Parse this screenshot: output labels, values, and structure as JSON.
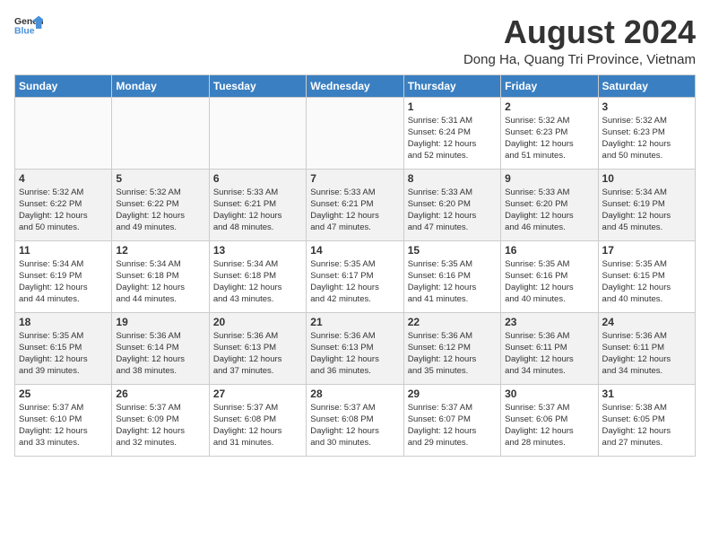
{
  "logo": {
    "text_general": "General",
    "text_blue": "Blue"
  },
  "header": {
    "title": "August 2024",
    "subtitle": "Dong Ha, Quang Tri Province, Vietnam"
  },
  "weekdays": [
    "Sunday",
    "Monday",
    "Tuesday",
    "Wednesday",
    "Thursday",
    "Friday",
    "Saturday"
  ],
  "weeks": [
    [
      {
        "day": "",
        "info": ""
      },
      {
        "day": "",
        "info": ""
      },
      {
        "day": "",
        "info": ""
      },
      {
        "day": "",
        "info": ""
      },
      {
        "day": "1",
        "info": "Sunrise: 5:31 AM\nSunset: 6:24 PM\nDaylight: 12 hours\nand 52 minutes."
      },
      {
        "day": "2",
        "info": "Sunrise: 5:32 AM\nSunset: 6:23 PM\nDaylight: 12 hours\nand 51 minutes."
      },
      {
        "day": "3",
        "info": "Sunrise: 5:32 AM\nSunset: 6:23 PM\nDaylight: 12 hours\nand 50 minutes."
      }
    ],
    [
      {
        "day": "4",
        "info": "Sunrise: 5:32 AM\nSunset: 6:22 PM\nDaylight: 12 hours\nand 50 minutes."
      },
      {
        "day": "5",
        "info": "Sunrise: 5:32 AM\nSunset: 6:22 PM\nDaylight: 12 hours\nand 49 minutes."
      },
      {
        "day": "6",
        "info": "Sunrise: 5:33 AM\nSunset: 6:21 PM\nDaylight: 12 hours\nand 48 minutes."
      },
      {
        "day": "7",
        "info": "Sunrise: 5:33 AM\nSunset: 6:21 PM\nDaylight: 12 hours\nand 47 minutes."
      },
      {
        "day": "8",
        "info": "Sunrise: 5:33 AM\nSunset: 6:20 PM\nDaylight: 12 hours\nand 47 minutes."
      },
      {
        "day": "9",
        "info": "Sunrise: 5:33 AM\nSunset: 6:20 PM\nDaylight: 12 hours\nand 46 minutes."
      },
      {
        "day": "10",
        "info": "Sunrise: 5:34 AM\nSunset: 6:19 PM\nDaylight: 12 hours\nand 45 minutes."
      }
    ],
    [
      {
        "day": "11",
        "info": "Sunrise: 5:34 AM\nSunset: 6:19 PM\nDaylight: 12 hours\nand 44 minutes."
      },
      {
        "day": "12",
        "info": "Sunrise: 5:34 AM\nSunset: 6:18 PM\nDaylight: 12 hours\nand 44 minutes."
      },
      {
        "day": "13",
        "info": "Sunrise: 5:34 AM\nSunset: 6:18 PM\nDaylight: 12 hours\nand 43 minutes."
      },
      {
        "day": "14",
        "info": "Sunrise: 5:35 AM\nSunset: 6:17 PM\nDaylight: 12 hours\nand 42 minutes."
      },
      {
        "day": "15",
        "info": "Sunrise: 5:35 AM\nSunset: 6:16 PM\nDaylight: 12 hours\nand 41 minutes."
      },
      {
        "day": "16",
        "info": "Sunrise: 5:35 AM\nSunset: 6:16 PM\nDaylight: 12 hours\nand 40 minutes."
      },
      {
        "day": "17",
        "info": "Sunrise: 5:35 AM\nSunset: 6:15 PM\nDaylight: 12 hours\nand 40 minutes."
      }
    ],
    [
      {
        "day": "18",
        "info": "Sunrise: 5:35 AM\nSunset: 6:15 PM\nDaylight: 12 hours\nand 39 minutes."
      },
      {
        "day": "19",
        "info": "Sunrise: 5:36 AM\nSunset: 6:14 PM\nDaylight: 12 hours\nand 38 minutes."
      },
      {
        "day": "20",
        "info": "Sunrise: 5:36 AM\nSunset: 6:13 PM\nDaylight: 12 hours\nand 37 minutes."
      },
      {
        "day": "21",
        "info": "Sunrise: 5:36 AM\nSunset: 6:13 PM\nDaylight: 12 hours\nand 36 minutes."
      },
      {
        "day": "22",
        "info": "Sunrise: 5:36 AM\nSunset: 6:12 PM\nDaylight: 12 hours\nand 35 minutes."
      },
      {
        "day": "23",
        "info": "Sunrise: 5:36 AM\nSunset: 6:11 PM\nDaylight: 12 hours\nand 34 minutes."
      },
      {
        "day": "24",
        "info": "Sunrise: 5:36 AM\nSunset: 6:11 PM\nDaylight: 12 hours\nand 34 minutes."
      }
    ],
    [
      {
        "day": "25",
        "info": "Sunrise: 5:37 AM\nSunset: 6:10 PM\nDaylight: 12 hours\nand 33 minutes."
      },
      {
        "day": "26",
        "info": "Sunrise: 5:37 AM\nSunset: 6:09 PM\nDaylight: 12 hours\nand 32 minutes."
      },
      {
        "day": "27",
        "info": "Sunrise: 5:37 AM\nSunset: 6:08 PM\nDaylight: 12 hours\nand 31 minutes."
      },
      {
        "day": "28",
        "info": "Sunrise: 5:37 AM\nSunset: 6:08 PM\nDaylight: 12 hours\nand 30 minutes."
      },
      {
        "day": "29",
        "info": "Sunrise: 5:37 AM\nSunset: 6:07 PM\nDaylight: 12 hours\nand 29 minutes."
      },
      {
        "day": "30",
        "info": "Sunrise: 5:37 AM\nSunset: 6:06 PM\nDaylight: 12 hours\nand 28 minutes."
      },
      {
        "day": "31",
        "info": "Sunrise: 5:38 AM\nSunset: 6:05 PM\nDaylight: 12 hours\nand 27 minutes."
      }
    ]
  ]
}
